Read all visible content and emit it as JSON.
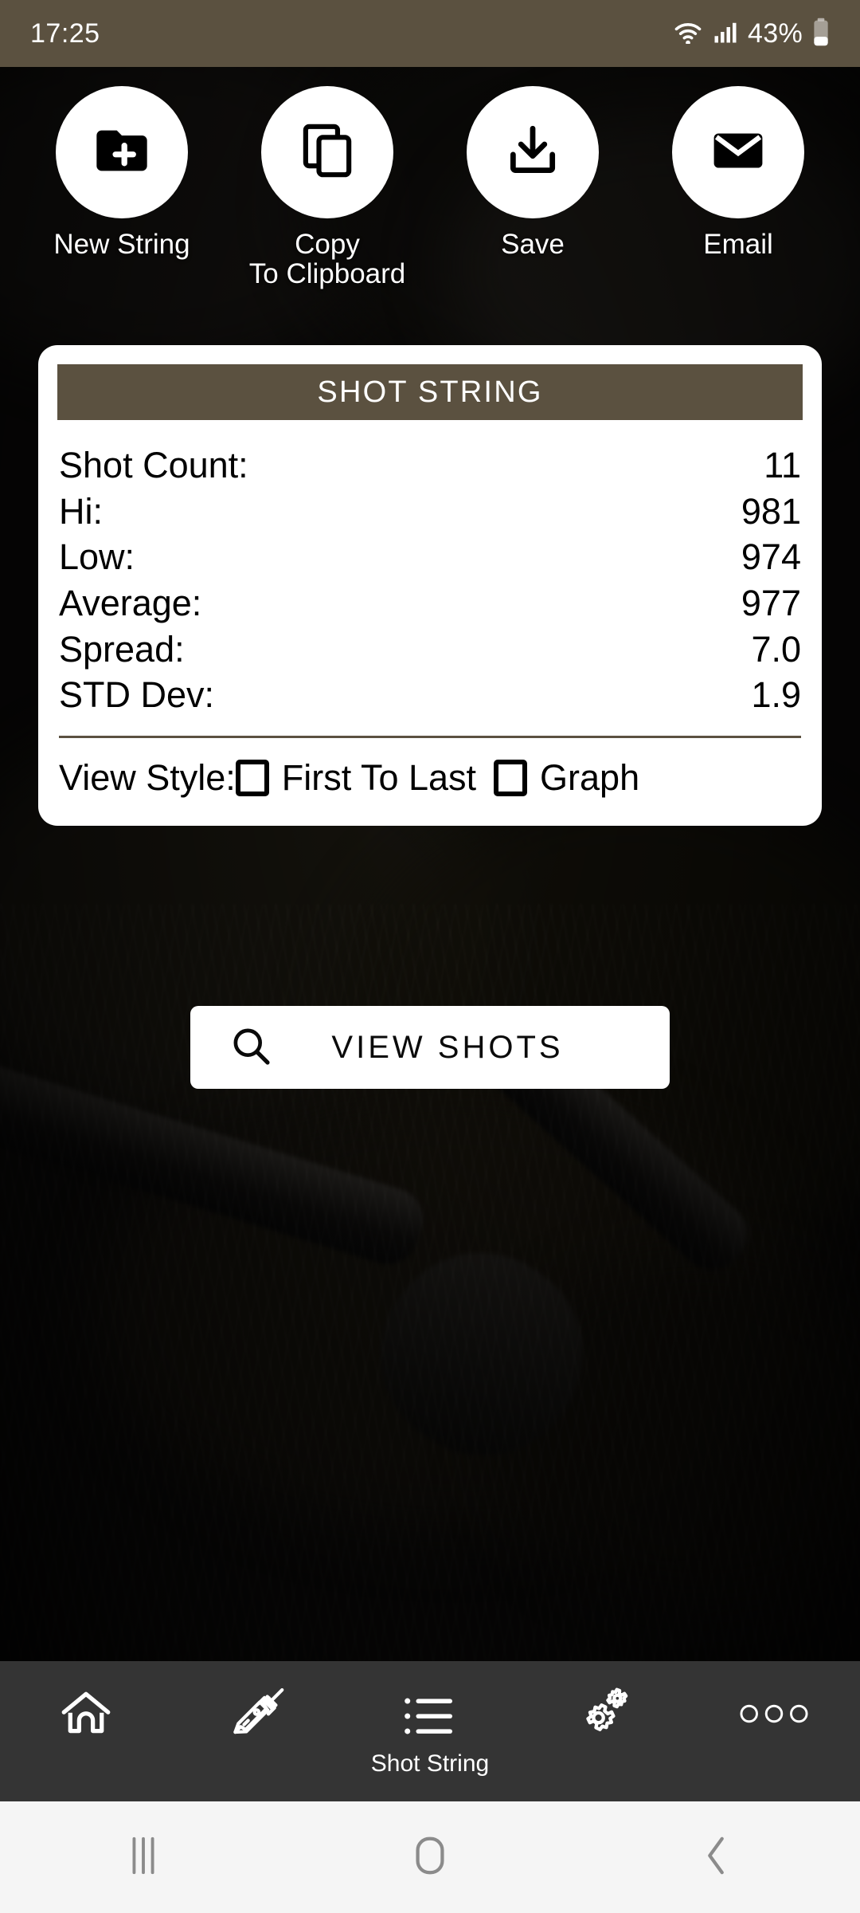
{
  "status_bar": {
    "time": "17:25",
    "battery_percent": "43%",
    "wifi_icon": "wifi-icon",
    "signal_icon": "signal-bars-icon",
    "battery_icon": "battery-icon",
    "background_color": "#5b5140"
  },
  "actions": [
    {
      "label": "New String",
      "icon": "folder-plus-icon"
    },
    {
      "label": "Copy\nTo Clipboard",
      "icon": "copy-icon"
    },
    {
      "label": "Save",
      "icon": "download-icon"
    },
    {
      "label": "Email",
      "icon": "envelope-icon"
    }
  ],
  "card": {
    "title": "SHOT STRING",
    "title_bar_color": "#5b5140",
    "stats": [
      {
        "label": "Shot Count:",
        "value": "11"
      },
      {
        "label": "Hi:",
        "value": "981"
      },
      {
        "label": "Low:",
        "value": "974"
      },
      {
        "label": "Average:",
        "value": "977"
      },
      {
        "label": "Spread:",
        "value": "7.0"
      },
      {
        "label": "STD Dev:",
        "value": "1.9"
      }
    ],
    "view_style": {
      "label": "View Style:",
      "options": [
        {
          "label": "First To Last",
          "checked": false
        },
        {
          "label": "Graph",
          "checked": false
        }
      ]
    }
  },
  "view_shots_button": {
    "label": "VIEW SHOTS",
    "icon": "search-icon"
  },
  "bottom_nav": {
    "background_color": "#343434",
    "items": [
      {
        "label": "",
        "icon": "home-icon",
        "active": false
      },
      {
        "label": "",
        "icon": "rifle-scope-icon",
        "active": false
      },
      {
        "label": "Shot String",
        "icon": "list-icon",
        "active": true
      },
      {
        "label": "",
        "icon": "gears-icon",
        "active": false
      },
      {
        "label": "",
        "icon": "more-dots-icon",
        "active": false
      }
    ]
  },
  "system_nav": {
    "background_color": "#f5f5f5",
    "items": [
      {
        "icon": "recents-icon"
      },
      {
        "icon": "home-pill-icon"
      },
      {
        "icon": "back-chevron-icon"
      }
    ]
  }
}
